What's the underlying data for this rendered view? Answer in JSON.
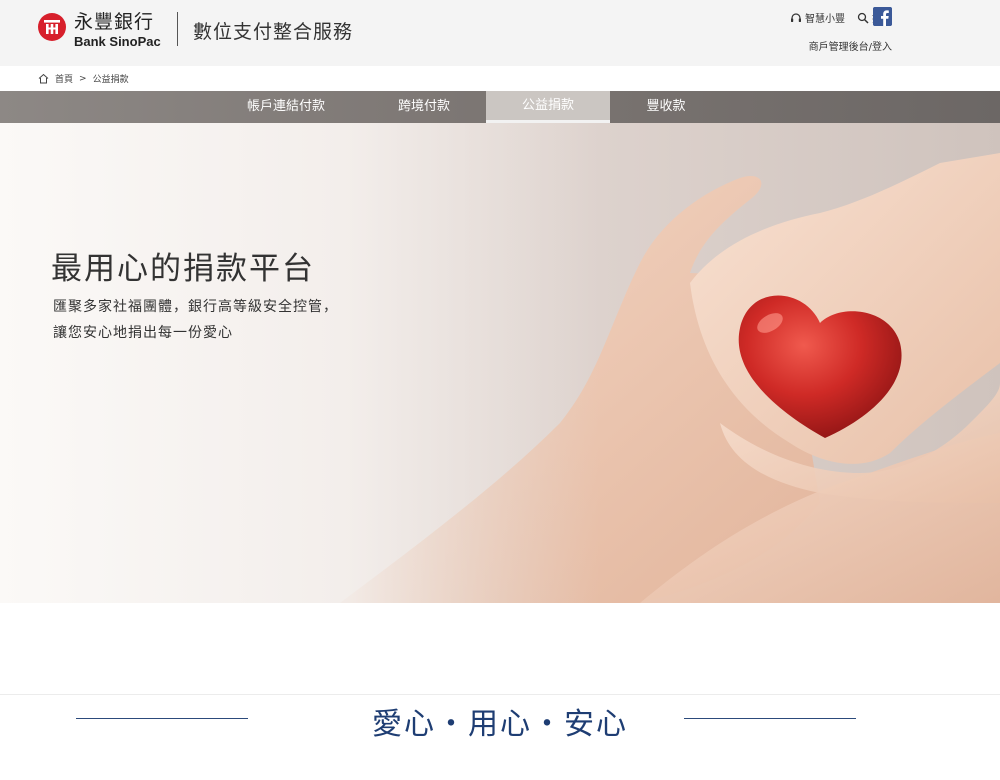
{
  "header": {
    "bank_name_cn": "永豐銀行",
    "bank_name_en": "Bank SinoPac",
    "service_title": "數位支付整合服務",
    "utility_links": [
      {
        "label": "智慧小豐",
        "icon": "headset-icon"
      },
      {
        "label": "搜尋",
        "icon": "search-icon"
      }
    ],
    "facebook_icon": "facebook-icon",
    "merchant_link": "商戶管理後台/登入"
  },
  "breadcrumb": {
    "home": "首頁",
    "separator": ">",
    "current": "公益捐款"
  },
  "nav": {
    "items": [
      {
        "label": "帳戶連結付款",
        "active": false
      },
      {
        "label": "跨境付款",
        "active": false
      },
      {
        "label": "公益捐款",
        "active": true
      },
      {
        "label": "豐收款",
        "active": false
      }
    ]
  },
  "hero": {
    "title": "最用心的捐款平台",
    "line1": "匯聚多家社福團體，銀行高等級安全控管，",
    "line2": "讓您安心地捐出每一份愛心",
    "image": "hands-holding-red-heart"
  },
  "section": {
    "heading": "愛心・用心・安心"
  },
  "colors": {
    "brand_red": "#d71f2b",
    "nav_bg": "#7b7572",
    "heading_blue": "#1e3d73",
    "facebook_blue": "#3b5998"
  }
}
